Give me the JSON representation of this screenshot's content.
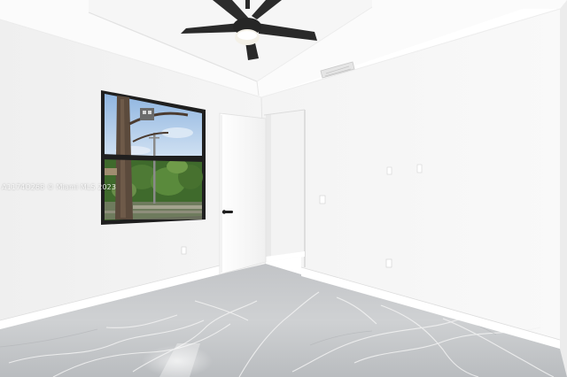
{
  "photo": {
    "subject": "empty-bedroom",
    "watermark": "A1174O268 © Miami MLS 2023"
  },
  "colors": {
    "wall_left": "#f2f2f2",
    "wall_right": "#f6f6f6",
    "ceiling": "#fbfbfb",
    "floor": "#c9cbcd",
    "door": "#fbfbfb",
    "window_frame": "#1f1f1f",
    "sky": "#a9c6e6",
    "foliage": "#4e7a35",
    "fan": "#2a2a2a"
  },
  "icons": [
    "ceiling-fan-icon",
    "door-handle-icon",
    "outlet-icon",
    "light-switch-icon",
    "air-vent-icon"
  ]
}
